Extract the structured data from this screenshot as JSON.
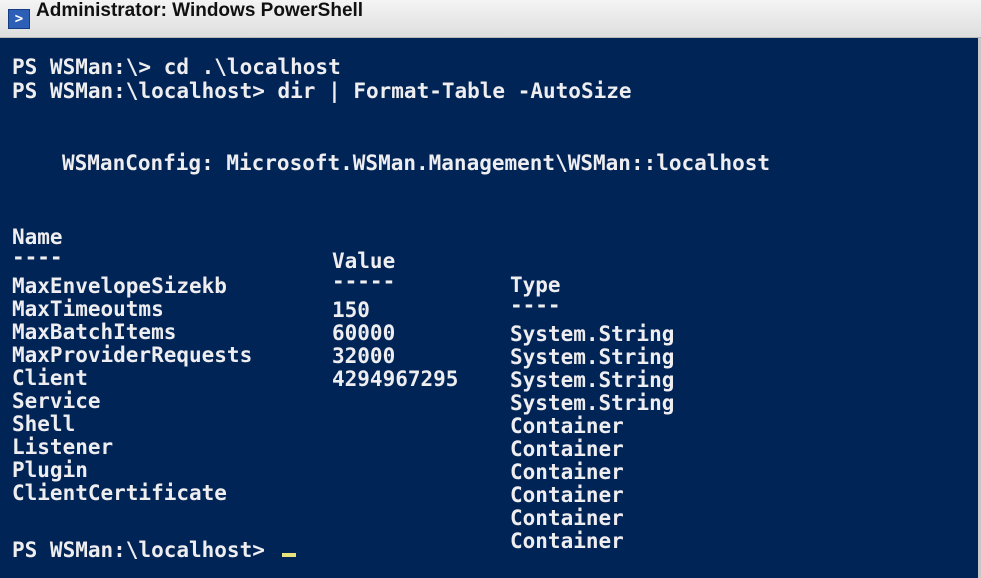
{
  "window": {
    "title": "Administrator: Windows PowerShell",
    "icon": "powershell-icon"
  },
  "console": {
    "command_1": "PS WSMan:\\> cd .\\localhost",
    "command_2": "PS WSMan:\\localhost> dir | Format-Table -AutoSize",
    "config_header": "WSManConfig: Microsoft.WSMan.Management\\WSMan::localhost",
    "table": {
      "headers": [
        "Name",
        "Value",
        "Type"
      ],
      "separators": [
        "----",
        "-----",
        "----"
      ],
      "rows": [
        {
          "name": "MaxEnvelopeSizekb",
          "value": "150",
          "type": "System.String"
        },
        {
          "name": "MaxTimeoutms",
          "value": "60000",
          "type": "System.String"
        },
        {
          "name": "MaxBatchItems",
          "value": "32000",
          "type": "System.String"
        },
        {
          "name": "MaxProviderRequests",
          "value": "4294967295",
          "type": "System.String"
        },
        {
          "name": "Client",
          "value": "",
          "type": "Container"
        },
        {
          "name": "Service",
          "value": "",
          "type": "Container"
        },
        {
          "name": "Shell",
          "value": "",
          "type": "Container"
        },
        {
          "name": "Listener",
          "value": "",
          "type": "Container"
        },
        {
          "name": "Plugin",
          "value": "",
          "type": "Container"
        },
        {
          "name": "ClientCertificate",
          "value": "",
          "type": "Container"
        }
      ]
    },
    "prompt": "PS WSMan:\\localhost>"
  },
  "colors": {
    "console_background": "#012456",
    "console_text": "#eeedf0",
    "cursor": "#e8e27a"
  }
}
